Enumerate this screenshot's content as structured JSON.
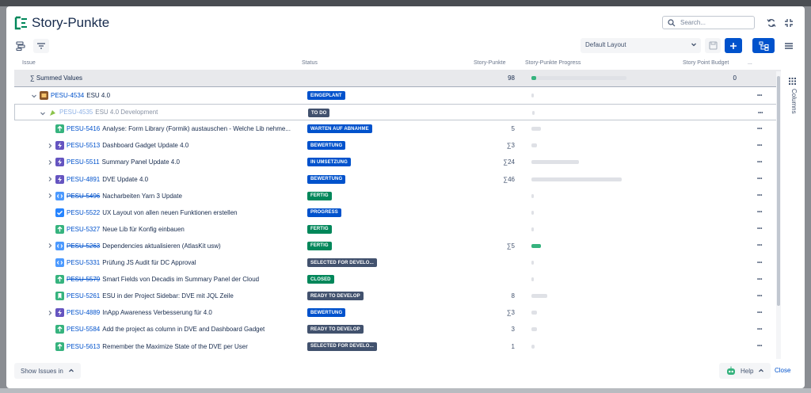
{
  "app": {
    "title": "Story-Punkte"
  },
  "search": {
    "placeholder": "Search..."
  },
  "toolbar": {
    "layout_label": "Default Layout"
  },
  "columns": {
    "issue": "Issue",
    "status": "Status",
    "points": "Story-Punkte",
    "progress": "Story-Punkte Progress",
    "budget": "Story Point Budget",
    "more": "..."
  },
  "summary": {
    "label": "∑ Summed Values",
    "points": "98",
    "budget": "0",
    "progress": 0.05
  },
  "status_colors": {
    "blue": "#0052cc",
    "green": "#00875a",
    "grey": "#42526e"
  },
  "rows": [
    {
      "key": "PESU-4534",
      "summary": "ESU 4.0",
      "status": "EINGEPLANT",
      "status_color": "blue",
      "points": "",
      "progress": 0.0,
      "indent": 0,
      "expander": "open",
      "type": "epic",
      "strike": false,
      "faded": false
    },
    {
      "key": "PESU-4535",
      "summary": "ESU 4.0 Development",
      "status": "TO DO",
      "status_color": "grey",
      "points": "",
      "progress": 0.0,
      "indent": 1,
      "expander": "open",
      "type": "subepic",
      "strike": false,
      "faded": true
    },
    {
      "key": "PESU-5416",
      "summary": "Analyse: Form Library (Formik) austauschen - Welche Lib nehme...",
      "status": "WARTEN AUF ABNAHME",
      "status_color": "blue",
      "points": "5",
      "progress": 0.1,
      "indent": 2,
      "expander": "",
      "type": "story",
      "strike": false,
      "faded": false
    },
    {
      "key": "PESU-5513",
      "summary": "Dashboard Gadget Update 4.0",
      "status": "BEWERTUNG",
      "status_color": "blue",
      "points": "∑3",
      "progress": 0.06,
      "indent": 2,
      "expander": "closed",
      "type": "epic-purple",
      "strike": false,
      "faded": false
    },
    {
      "key": "PESU-5511",
      "summary": "Summary Panel Update 4.0",
      "status": "IN UMSETZUNG",
      "status_color": "blue",
      "points": "∑24",
      "progress": 0.5,
      "indent": 2,
      "expander": "closed",
      "type": "epic-purple",
      "strike": false,
      "faded": false
    },
    {
      "key": "PESU-4891",
      "summary": "DVE Update 4.0",
      "status": "BEWERTUNG",
      "status_color": "blue",
      "points": "∑46",
      "progress": 0.95,
      "indent": 2,
      "expander": "closed",
      "type": "epic-purple",
      "strike": false,
      "faded": false
    },
    {
      "key": "PESU-5496",
      "summary": "Nacharbeiten Yarn 3 Update",
      "status": "FERTIG",
      "status_color": "green",
      "points": "",
      "progress": 0.0,
      "indent": 2,
      "expander": "closed",
      "type": "task-blue",
      "strike": true,
      "faded": false
    },
    {
      "key": "PESU-5522",
      "summary": "UX Layout von allen neuen Funktionen erstellen",
      "status": "PROGRESS",
      "status_color": "blue",
      "points": "",
      "progress": 0.0,
      "indent": 2,
      "expander": "",
      "type": "check",
      "strike": false,
      "faded": false
    },
    {
      "key": "PESU-5327",
      "summary": "Neue Lib für Konfig einbauen",
      "status": "FERTIG",
      "status_color": "green",
      "points": "",
      "progress": 0.0,
      "indent": 2,
      "expander": "",
      "type": "story",
      "strike": false,
      "faded": false
    },
    {
      "key": "PESU-5263",
      "summary": "Dependencies aktualisieren (AtlasKit usw)",
      "status": "FERTIG",
      "status_color": "green",
      "points": "∑5",
      "progress": 0.1,
      "progress_done": true,
      "indent": 2,
      "expander": "closed",
      "type": "task-blue",
      "strike": true,
      "faded": false
    },
    {
      "key": "PESU-5331",
      "summary": "Prüfung JS Audit für DC Approval",
      "status": "SELECTED FOR DEVELO...",
      "status_color": "grey",
      "points": "",
      "progress": 0.0,
      "indent": 2,
      "expander": "",
      "type": "task-blue",
      "strike": false,
      "faded": false
    },
    {
      "key": "PESU-5579",
      "summary": "Smart Fields von Decadis im Summary Panel der Cloud",
      "status": "CLOSED",
      "status_color": "green",
      "points": "",
      "progress": 0.0,
      "indent": 2,
      "expander": "",
      "type": "story",
      "strike": true,
      "faded": false
    },
    {
      "key": "PESU-5261",
      "summary": "ESU in der Project Sidebar: DVE mit JQL Zeile",
      "status": "READY TO DEVELOP",
      "status_color": "grey",
      "points": "8",
      "progress": 0.17,
      "indent": 2,
      "expander": "",
      "type": "bookmark",
      "strike": false,
      "faded": false
    },
    {
      "key": "PESU-4889",
      "summary": "InApp Awareness Verbesserung für 4.0",
      "status": "BEWERTUNG",
      "status_color": "blue",
      "points": "∑3",
      "progress": 0.06,
      "indent": 2,
      "expander": "closed",
      "type": "epic-purple",
      "strike": false,
      "faded": false
    },
    {
      "key": "PESU-5584",
      "summary": "Add the project as column in DVE and Dashboard Gadget",
      "status": "READY TO DEVELOP",
      "status_color": "grey",
      "points": "3",
      "progress": 0.06,
      "indent": 2,
      "expander": "",
      "type": "story",
      "strike": false,
      "faded": false
    },
    {
      "key": "PESU-5613",
      "summary": "Remember the Maximize State of the DVE per User",
      "status": "SELECTED FOR DEVELO...",
      "status_color": "grey",
      "points": "1",
      "progress": 0.03,
      "indent": 2,
      "expander": "",
      "type": "story",
      "strike": false,
      "faded": false
    }
  ],
  "side_panel": {
    "label": "Columns"
  },
  "footer": {
    "show_issues_label": "Show Issues in",
    "help_label": "Help",
    "close_label": "Close"
  }
}
